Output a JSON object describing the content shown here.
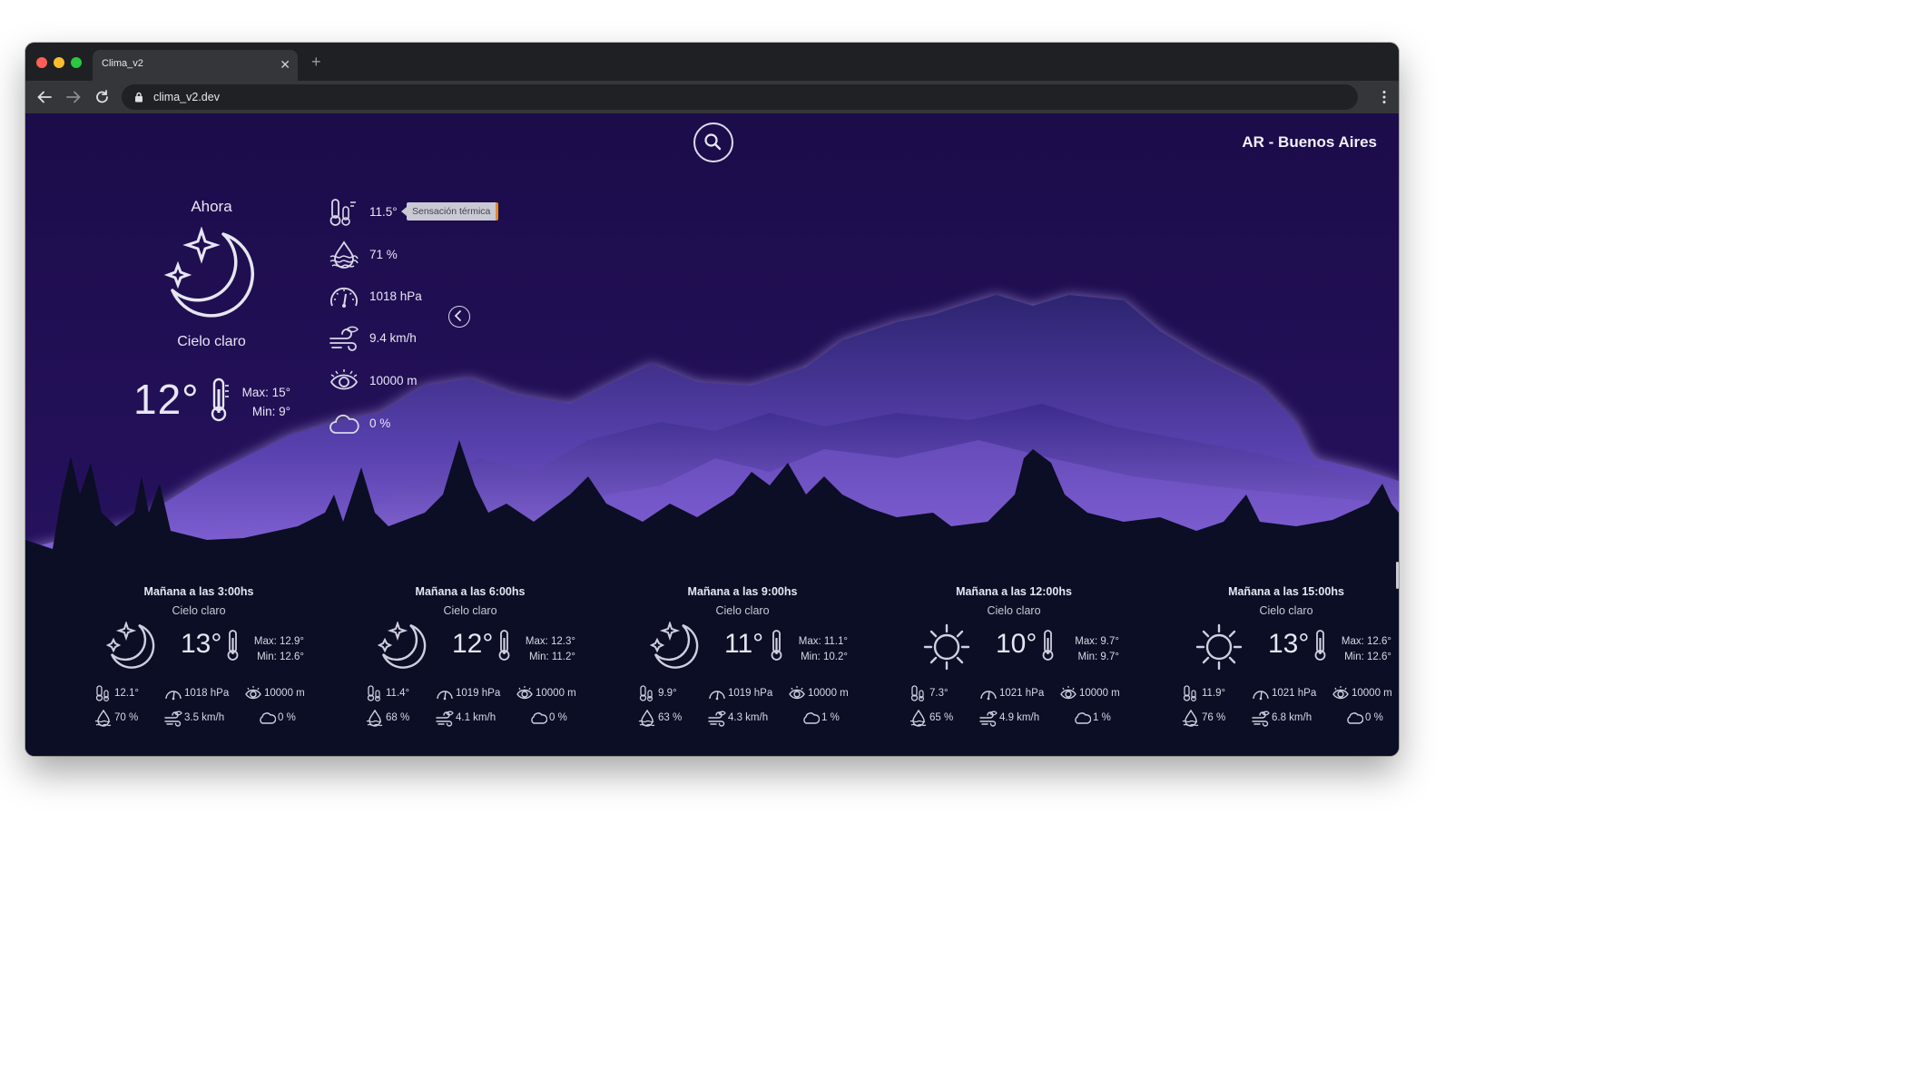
{
  "browser": {
    "tab_title": "Clima_v2",
    "url": "clima_v2.dev"
  },
  "header": {
    "location": "AR - Buenos Aires"
  },
  "current": {
    "label": "Ahora",
    "icon": "clear-night-icon",
    "description": "Cielo claro",
    "temp": "12°",
    "max": "Max: 15°",
    "min": "Min: 9°",
    "feels_like": "11.5°",
    "feels_like_tooltip": "Sensación térmica",
    "humidity": "71 %",
    "pressure": "1018 hPa",
    "wind": "9.4 km/h",
    "visibility": "10000 m",
    "clouds": "0 %"
  },
  "forecast": [
    {
      "title": "Mañana a las 3:00hs",
      "description": "Cielo claro",
      "icon": "clear-night-icon",
      "temp": "13°",
      "max": "Max: 12.9°",
      "min": "Min: 12.6°",
      "feels": "12.1°",
      "pressure": "1018 hPa",
      "visibility": "10000 m",
      "humidity": "70 %",
      "wind": "3.5 km/h",
      "clouds": "0 %"
    },
    {
      "title": "Mañana a las 6:00hs",
      "description": "Cielo claro",
      "icon": "clear-night-icon",
      "temp": "12°",
      "max": "Max: 12.3°",
      "min": "Min: 11.2°",
      "feels": "11.4°",
      "pressure": "1019 hPa",
      "visibility": "10000 m",
      "humidity": "68 %",
      "wind": "4.1 km/h",
      "clouds": "0 %"
    },
    {
      "title": "Mañana a las 9:00hs",
      "description": "Cielo claro",
      "icon": "clear-night-icon",
      "temp": "11°",
      "max": "Max: 11.1°",
      "min": "Min: 10.2°",
      "feels": "9.9°",
      "pressure": "1019 hPa",
      "visibility": "10000 m",
      "humidity": "63 %",
      "wind": "4.3 km/h",
      "clouds": "1 %"
    },
    {
      "title": "Mañana a las 12:00hs",
      "description": "Cielo claro",
      "icon": "sun-icon",
      "temp": "10°",
      "max": "Max: 9.7°",
      "min": "Min: 9.7°",
      "feels": "7.3°",
      "pressure": "1021 hPa",
      "visibility": "10000 m",
      "humidity": "65 %",
      "wind": "4.9 km/h",
      "clouds": "1 %"
    },
    {
      "title": "Mañana a las 15:00hs",
      "description": "Cielo claro",
      "icon": "sun-icon",
      "temp": "13°",
      "max": "Max: 12.6°",
      "min": "Min: 12.6°",
      "feels": "11.9°",
      "pressure": "1021 hPa",
      "visibility": "10000 m",
      "humidity": "76 %",
      "wind": "6.8 km/h",
      "clouds": "0 %"
    }
  ],
  "colors": {
    "sky": "#1e0e50",
    "mountain_glow": "#8f78e8",
    "ground": "#0b0e24",
    "text": "#e8e6f4"
  }
}
